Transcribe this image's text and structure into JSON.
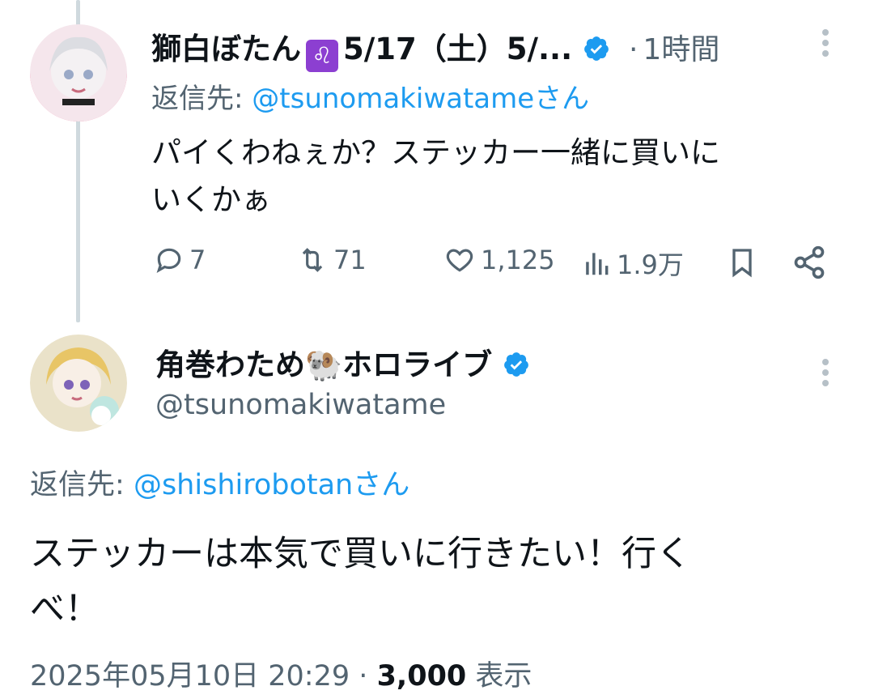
{
  "tweet1": {
    "display_name": "獅白ぼたん",
    "name_suffix": "5/17（土）5/...",
    "zodiac_emoji": "♌",
    "time_sep": "·",
    "time": "1時間",
    "reply_prefix": "返信先:",
    "reply_handle": "@tsunomakiwatameさん",
    "text_line1": "パイくわねぇか？ステッカー一緒に買いに",
    "text_line2": "いくかぁ",
    "replies": "7",
    "retweets": "71",
    "likes": "1,125",
    "views": "1.9万",
    "avatar_bg": "#f0d9e3",
    "avatar_accent": "#e0245e"
  },
  "tweet2": {
    "display_name": "角巻わため",
    "name_emoji": "🐏",
    "name_suffix": "ホロライブ",
    "handle": "@tsunomakiwatame",
    "reply_prefix": "返信先:",
    "reply_handle": "@shishirobotanさん",
    "text_line1": "ステッカーは本気で買いに行きたい！行く",
    "text_line2": "べ！",
    "date": "2025年05月10日 20:29",
    "meta_sep": "·",
    "view_count": "3,000",
    "view_label": "表示",
    "avatar_bg": "#f3ead2",
    "avatar_accent": "#e8c566"
  },
  "colors": {
    "link": "#1d9bf0",
    "muted": "#536471",
    "verified": "#1d9bf0",
    "text": "#0f1419"
  }
}
